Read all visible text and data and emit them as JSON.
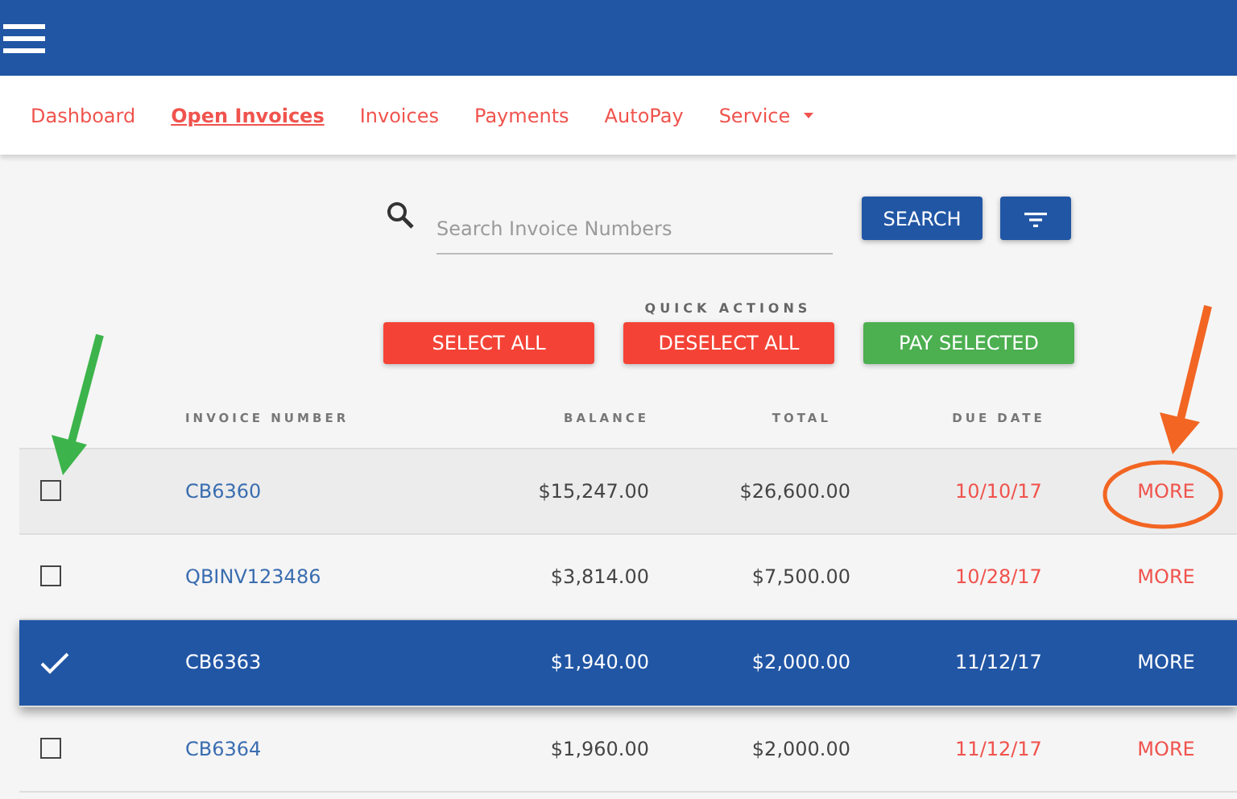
{
  "nav": [
    {
      "label": "Dashboard",
      "selected": false,
      "dropdown": false
    },
    {
      "label": "Open Invoices",
      "selected": true,
      "dropdown": false
    },
    {
      "label": "Invoices",
      "selected": false,
      "dropdown": false
    },
    {
      "label": "Payments",
      "selected": false,
      "dropdown": false
    },
    {
      "label": "AutoPay",
      "selected": false,
      "dropdown": false
    },
    {
      "label": "Service",
      "selected": false,
      "dropdown": true
    }
  ],
  "search": {
    "placeholder": "Search Invoice Numbers",
    "button": "SEARCH"
  },
  "quick_actions": {
    "label": "QUICK ACTIONS",
    "buttons": [
      {
        "label": "SELECT ALL",
        "kind": "danger"
      },
      {
        "label": "DESELECT ALL",
        "kind": "danger"
      },
      {
        "label": "PAY SELECTED",
        "kind": "success"
      }
    ]
  },
  "table": {
    "columns": [
      "INVOICE NUMBER",
      "BALANCE",
      "TOTAL",
      "DUE DATE"
    ],
    "rows": [
      {
        "invoice": "CB6360",
        "balance": "$15,247.00",
        "total": "$26,600.00",
        "due_date": "10/10/17",
        "action": "MORE",
        "selected": false,
        "highlighted": true
      },
      {
        "invoice": "QBINV123486",
        "balance": "$3,814.00",
        "total": "$7,500.00",
        "due_date": "10/28/17",
        "action": "MORE",
        "selected": false,
        "highlighted": false
      },
      {
        "invoice": "CB6363",
        "balance": "$1,940.00",
        "total": "$2,000.00",
        "due_date": "11/12/17",
        "action": "MORE",
        "selected": true,
        "highlighted": false
      },
      {
        "invoice": "CB6364",
        "balance": "$1,960.00",
        "total": "$2,000.00",
        "due_date": "11/12/17",
        "action": "MORE",
        "selected": false,
        "highlighted": false
      }
    ]
  },
  "annotations": [
    {
      "kind": "arrow",
      "color": "#3cb44b"
    },
    {
      "kind": "arrow-circle",
      "color": "#f26522"
    }
  ]
}
